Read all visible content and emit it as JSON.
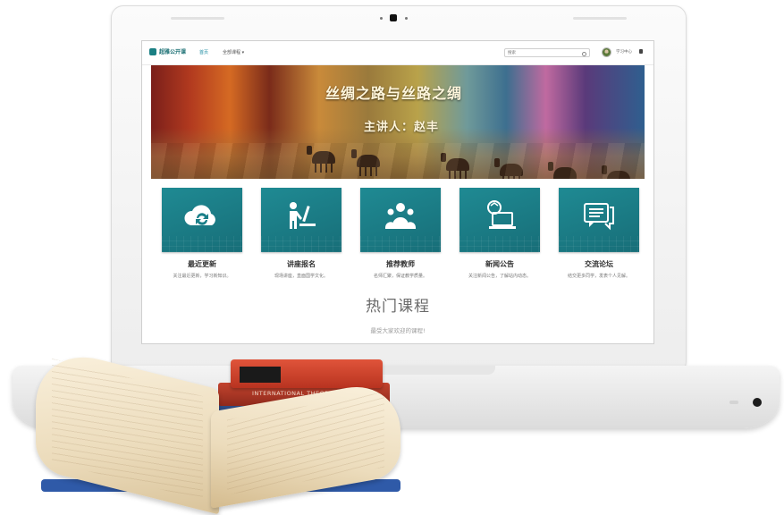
{
  "header": {
    "logo_text": "超雅公开课",
    "nav": [
      "首页",
      "全部课程 ▾"
    ],
    "search_placeholder": "搜索",
    "user_name": "学习中心"
  },
  "banner": {
    "title": "丝绸之路与丝路之绸",
    "speaker": "主讲人：赵丰"
  },
  "features": [
    {
      "title": "最近更新",
      "desc": "关注最近更新，学习新知识。",
      "icon": "cloud-sync-icon"
    },
    {
      "title": "讲座报名",
      "desc": "现场讲座，直面国学文化。",
      "icon": "lecture-icon"
    },
    {
      "title": "推荐教师",
      "desc": "名师汇聚，保证教学质量。",
      "icon": "teachers-icon"
    },
    {
      "title": "新闻公告",
      "desc": "关注新闻公告，了解站内动态。",
      "icon": "news-icon"
    },
    {
      "title": "交流论坛",
      "desc": "结交更多同学，发表个人见解。",
      "icon": "forum-icon"
    }
  ],
  "hot": {
    "title": "热门课程",
    "subtitle": "最受大家欢迎的课程!"
  },
  "books": {
    "spine_1": "INTERNATIONAL THEORY",
    "spine_2": "CE"
  },
  "colors": {
    "tile": "#1a7f88",
    "accent": "#1a8aa0"
  }
}
